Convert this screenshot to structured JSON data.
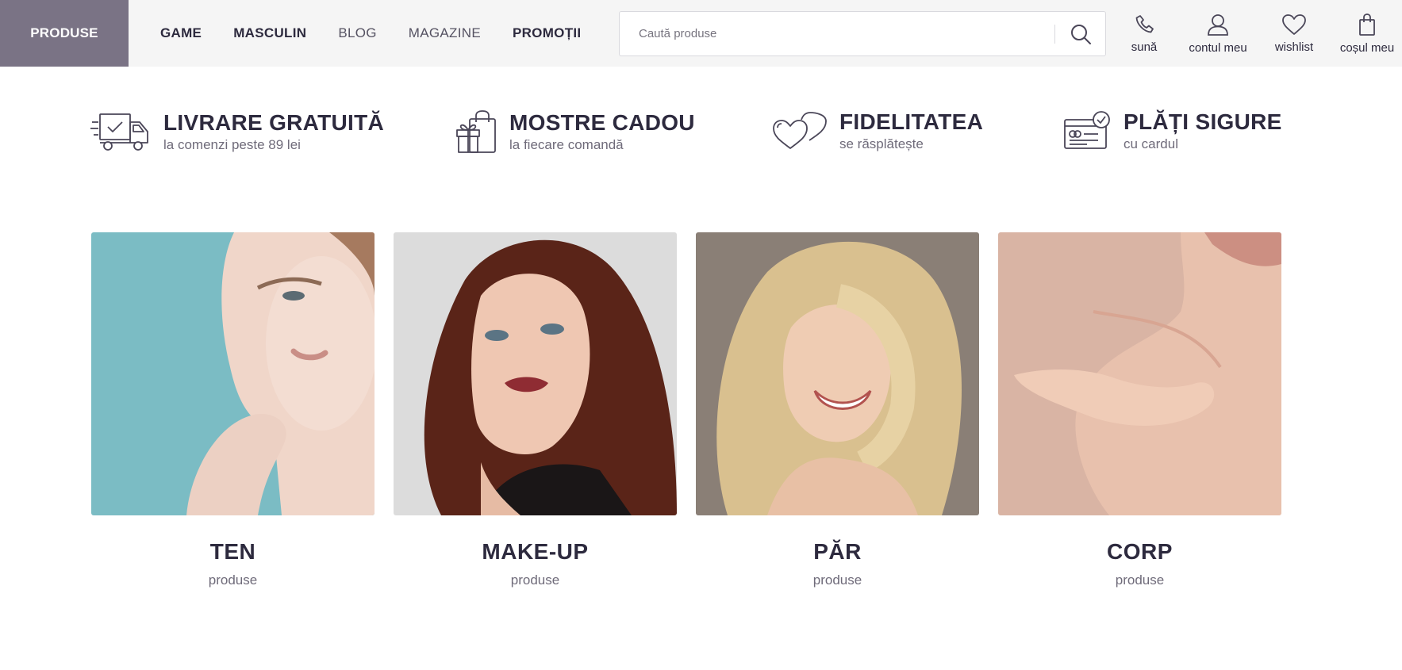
{
  "header": {
    "brand_button": "PRODUSE",
    "nav": [
      {
        "label": "GAME",
        "style": "bold"
      },
      {
        "label": "MASCULIN",
        "style": "bold"
      },
      {
        "label": "BLOG",
        "style": "light"
      },
      {
        "label": "MAGAZINE",
        "style": "light"
      },
      {
        "label": "PROMOȚII",
        "style": "bold"
      }
    ],
    "search": {
      "placeholder": "Caută produse",
      "value": ""
    },
    "utilities": [
      {
        "icon": "phone-icon",
        "label": "sună"
      },
      {
        "icon": "user-icon",
        "label": "contul meu"
      },
      {
        "icon": "heart-icon",
        "label": "wishlist"
      },
      {
        "icon": "shopping-bag-icon",
        "label": "coșul meu"
      }
    ]
  },
  "benefits": [
    {
      "icon": "delivery-truck-icon",
      "title": "LIVRARE GRATUITĂ",
      "subtitle": "la comenzi peste 89 lei"
    },
    {
      "icon": "gift-bag-icon",
      "title": "MOSTRE CADOU",
      "subtitle": "la fiecare comandă"
    },
    {
      "icon": "hearts-icon",
      "title": "FIDELITATEA",
      "subtitle": "se răsplătește"
    },
    {
      "icon": "secure-card-icon",
      "title": "PLĂȚI SIGURE",
      "subtitle": "cu cardul"
    }
  ],
  "categories": [
    {
      "name": "TEN",
      "subtitle": "produse"
    },
    {
      "name": "MAKE-UP",
      "subtitle": "produse"
    },
    {
      "name": "PĂR",
      "subtitle": "produse"
    },
    {
      "name": "CORP",
      "subtitle": "produse"
    }
  ],
  "colors": {
    "brand_button_bg": "#7a7385",
    "header_bg": "#f5f5f5",
    "text_dark": "#2d2a3e",
    "text_muted": "#6f6b7a"
  }
}
